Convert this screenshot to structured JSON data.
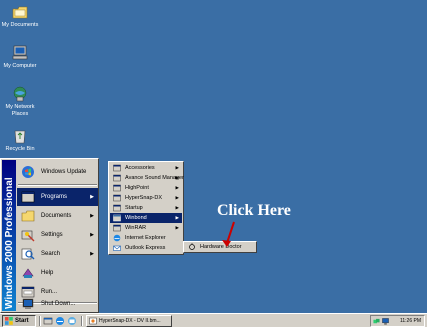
{
  "desktop": {
    "icons": [
      {
        "label": "My Documents",
        "icon": "folder-documents-icon"
      },
      {
        "label": "My Computer",
        "icon": "computer-icon"
      },
      {
        "label": "My Network Places",
        "icon": "network-icon"
      },
      {
        "label": "Recycle Bin",
        "icon": "recycle-bin-icon"
      }
    ],
    "background": "#3a6ea5"
  },
  "start_menu": {
    "banner": "Windows 2000 Professional",
    "items": [
      {
        "label": "Windows Update",
        "icon": "windows-update-icon"
      },
      {
        "label": "Programs",
        "icon": "programs-icon",
        "submenu": true
      },
      {
        "label": "Documents",
        "icon": "documents-icon",
        "submenu": true
      },
      {
        "label": "Settings",
        "icon": "settings-icon",
        "submenu": true
      },
      {
        "label": "Search",
        "icon": "search-icon",
        "submenu": true
      },
      {
        "label": "Help",
        "icon": "help-icon"
      },
      {
        "label": "Run...",
        "icon": "run-icon"
      },
      {
        "label": "Shut Down...",
        "icon": "shutdown-icon"
      }
    ]
  },
  "programs_menu": {
    "items": [
      {
        "label": "Accessories",
        "submenu": true
      },
      {
        "label": "Avance Sound Manager",
        "submenu": true
      },
      {
        "label": "HighPoint",
        "submenu": true
      },
      {
        "label": "HyperSnap-DX",
        "submenu": true
      },
      {
        "label": "Startup",
        "submenu": true
      },
      {
        "label": "Winbond",
        "submenu": true
      },
      {
        "label": "WinRAR",
        "submenu": true
      },
      {
        "label": "Internet Explorer",
        "submenu": false
      },
      {
        "label": "Outlook Express",
        "submenu": false
      }
    ]
  },
  "winbond_menu": {
    "items": [
      {
        "label": "Hardware Doctor"
      }
    ]
  },
  "annotation": {
    "text": "Click Here"
  },
  "taskbar": {
    "start_label": "Start",
    "task_label": "HyperSnap-DX - DV II.bm...",
    "clock": "11:26 PM"
  },
  "colors": {
    "selection": "#0a246a",
    "menu_face": "#d4d0c8",
    "arrow": "#cc0000"
  }
}
